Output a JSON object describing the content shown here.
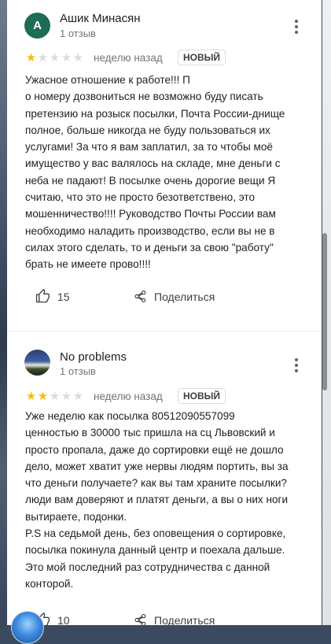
{
  "reviews": [
    {
      "avatar_letter": "А",
      "author": "Ашик Минасян",
      "review_count": "1 отзыв",
      "rating": 1,
      "rating_max": 5,
      "time": "неделю назад",
      "badge": "НОВЫЙ",
      "text": "Ужасное отношение к работе!!! П\nо номеру дозвониться не возможно буду писать\nпретензию на розыск посылки, Почта России-днище\nполное, больше никогда не буду пользоваться их\nуслугами! За что я вам заплатил, за то чтобы моё\nимущество у вас валялось на складе, мне деньги с\nнеба не падают! В посылке очень дорогие вещи Я\nсчитаю, что это не просто безответствено, это\nмошенничество!!!! Руководство Почты России вам\nнеобходимо наладить производство, если вы не в\nсилах этого сделать, то и деньги за свою \"работу\"\nбрать не имеете прово!!!!",
      "likes": "15",
      "share_label": "Поделиться"
    },
    {
      "author": "No problems",
      "review_count": "1 отзыв",
      "rating": 2,
      "rating_max": 5,
      "time": "неделю назад",
      "badge": "НОВЫЙ",
      "text": "Уже неделю как посылка 80512090557099\nценностью в 30000 тыс пришла на сц Львовский и\nпросто пропала, даже до сортировки ещё не дошло\nдело, может хватит уже нервы людям портить, вы за\nчто деньги получаете? как вы там храните посылки?\nлюди вам доверяют и платят деньги, а вы о них ноги\nвытираете, подонки.\nP.S  на седьмой день, без оповещения о сортировке,\nпосылка покинула данный центр и поехала дальше.\nЭто мой последний раз сотрудничества с данной\nконторой.",
      "likes": "10",
      "share_label": "Поделиться"
    }
  ],
  "colors": {
    "star_filled": "#fbbc04",
    "star_empty": "#dadce0",
    "avatar_1": "#1f6b55"
  },
  "icons": [
    "more-vert-icon",
    "thumb-up-icon",
    "share-icon",
    "star-icon"
  ]
}
